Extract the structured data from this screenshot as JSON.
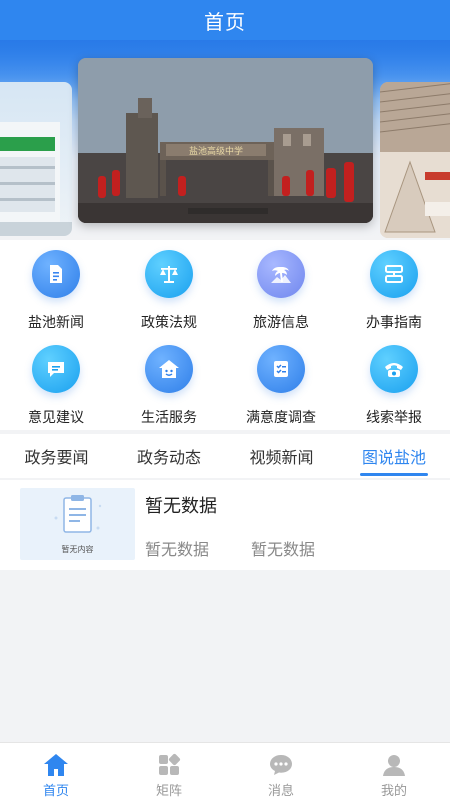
{
  "header": {
    "title": "首页"
  },
  "banner": {
    "gate_sign": "盐池高级中学"
  },
  "grid": {
    "items": [
      {
        "label": "盐池新闻",
        "icon": "document-icon"
      },
      {
        "label": "政策法规",
        "icon": "scale-icon"
      },
      {
        "label": "旅游信息",
        "icon": "palm-tree-icon"
      },
      {
        "label": "办事指南",
        "icon": "flow-chart-icon"
      },
      {
        "label": "意见建议",
        "icon": "message-icon"
      },
      {
        "label": "生活服务",
        "icon": "home-smile-icon"
      },
      {
        "label": "满意度调查",
        "icon": "checklist-icon"
      },
      {
        "label": "线索举报",
        "icon": "phone-icon"
      }
    ]
  },
  "tabs": {
    "items": [
      "政务要闻",
      "政务动态",
      "视频新闻",
      "图说盐池"
    ],
    "active_index": 3
  },
  "news": {
    "thumb_caption": "暂无内容",
    "title": "暂无数据",
    "meta_left": "暂无数据",
    "meta_right": "暂无数据"
  },
  "tabbar": {
    "items": [
      {
        "label": "首页",
        "icon": "home-icon"
      },
      {
        "label": "矩阵",
        "icon": "matrix-icon"
      },
      {
        "label": "消息",
        "icon": "chat-bubble-icon"
      },
      {
        "label": "我的",
        "icon": "user-icon"
      }
    ],
    "active_index": 0
  },
  "colors": {
    "primary": "#2f86ef",
    "inactive": "#999999",
    "text": "#222222"
  }
}
